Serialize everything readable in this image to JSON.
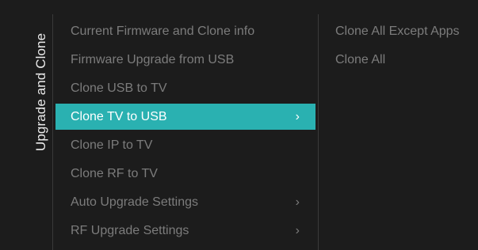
{
  "section_title": "Upgrade and Clone",
  "menu": {
    "items": [
      {
        "label": "Current Firmware and Clone info",
        "chevron": ""
      },
      {
        "label": "Firmware Upgrade from USB",
        "chevron": ""
      },
      {
        "label": "Clone USB to TV",
        "chevron": ""
      },
      {
        "label": "Clone TV to USB",
        "chevron": "›",
        "active": true
      },
      {
        "label": "Clone IP to TV",
        "chevron": ""
      },
      {
        "label": "Clone RF to TV",
        "chevron": ""
      },
      {
        "label": "Auto Upgrade Settings",
        "chevron": "›"
      },
      {
        "label": "RF Upgrade Settings",
        "chevron": "›"
      }
    ]
  },
  "submenu": {
    "items": [
      {
        "label": "Clone All Except Apps"
      },
      {
        "label": "Clone All"
      }
    ]
  },
  "colors": {
    "background": "#1c1c1c",
    "highlight": "#2ab1b1",
    "inactive_text": "#7c7c7c",
    "title_text": "#ececec"
  },
  "icons": {
    "chevron": "chevron-right-icon"
  }
}
